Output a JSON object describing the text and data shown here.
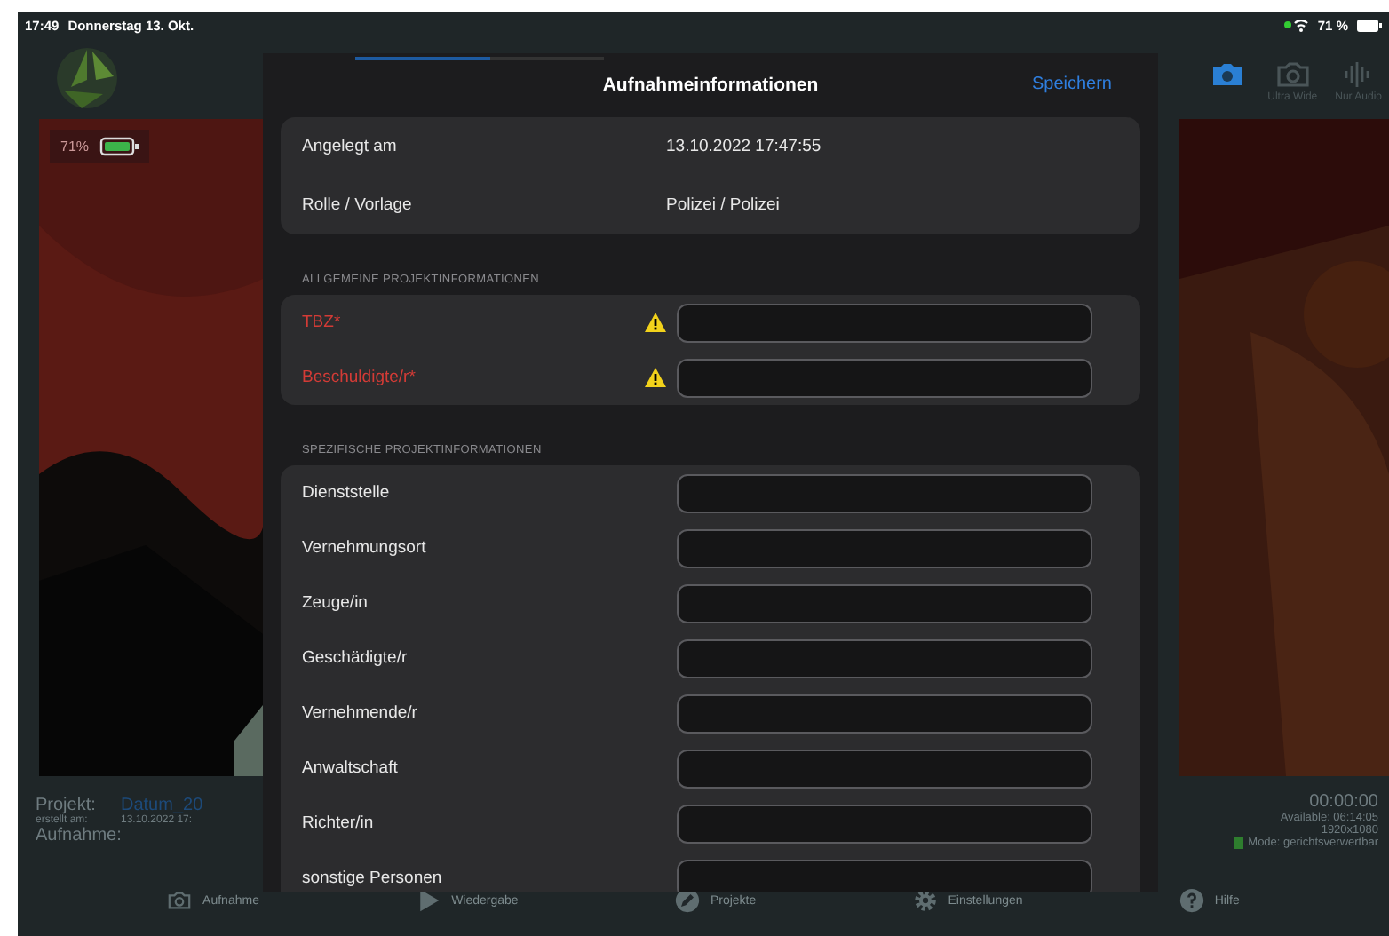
{
  "status_bar": {
    "time": "17:49",
    "date": "Donnerstag 13. Okt.",
    "battery": "71 %"
  },
  "camera_modes": [
    {
      "kind": "camera",
      "selected": true
    },
    {
      "kind": "camera",
      "label": "Ultra Wide",
      "selected": false
    },
    {
      "kind": "audio",
      "label": "Nur Audio",
      "selected": false
    }
  ],
  "preview": {
    "battery": "71%"
  },
  "recording_info": {
    "project_label": "Projekt:",
    "project": "Datum_20",
    "created_label": "erstellt am:",
    "created": "13.10.2022 17:",
    "recording_label": "Aufnahme:"
  },
  "timer": {
    "time": "00:00:00",
    "available": "Available: 06:14:05",
    "resolution": "1920x1080",
    "mode": "Mode: gerichtsverwertbar"
  },
  "tab_bar": [
    {
      "kind": "camera",
      "label": "Aufnahme"
    },
    {
      "kind": "play",
      "label": "Wiedergabe"
    },
    {
      "kind": "pencil",
      "label": "Projekte"
    },
    {
      "kind": "gear",
      "label": "Einstellungen"
    },
    {
      "kind": "help",
      "label": "Hilfe"
    }
  ],
  "dialog": {
    "title": "Aufnahmeinformationen",
    "save": "Speichern",
    "progress": {
      "level": 0.54
    },
    "info_rows": [
      {
        "label": "Angelegt am",
        "value": "13.10.2022 17:47:55"
      },
      {
        "label": "Rolle / Vorlage",
        "value": "Polizei / Polizei"
      }
    ],
    "sections": [
      {
        "header": "ALLGEMEINE PROJEKTINFORMATIONEN",
        "fields": [
          {
            "label": "TBZ*",
            "required": true
          },
          {
            "label": "Beschuldigte/r*",
            "required": true
          }
        ]
      },
      {
        "header": "SPEZIFISCHE PROJEKTINFORMATIONEN",
        "fields": [
          {
            "label": "Dienststelle",
            "required": false
          },
          {
            "label": "Vernehmungsort",
            "required": false
          },
          {
            "label": "Zeuge/in",
            "required": false
          },
          {
            "label": "Geschädigte/r",
            "required": false
          },
          {
            "label": "Vernehmende/r",
            "required": false
          },
          {
            "label": "Anwaltschaft",
            "required": false
          },
          {
            "label": "Richter/in",
            "required": false
          },
          {
            "label": "sonstige Personen",
            "required": false
          }
        ]
      }
    ]
  }
}
